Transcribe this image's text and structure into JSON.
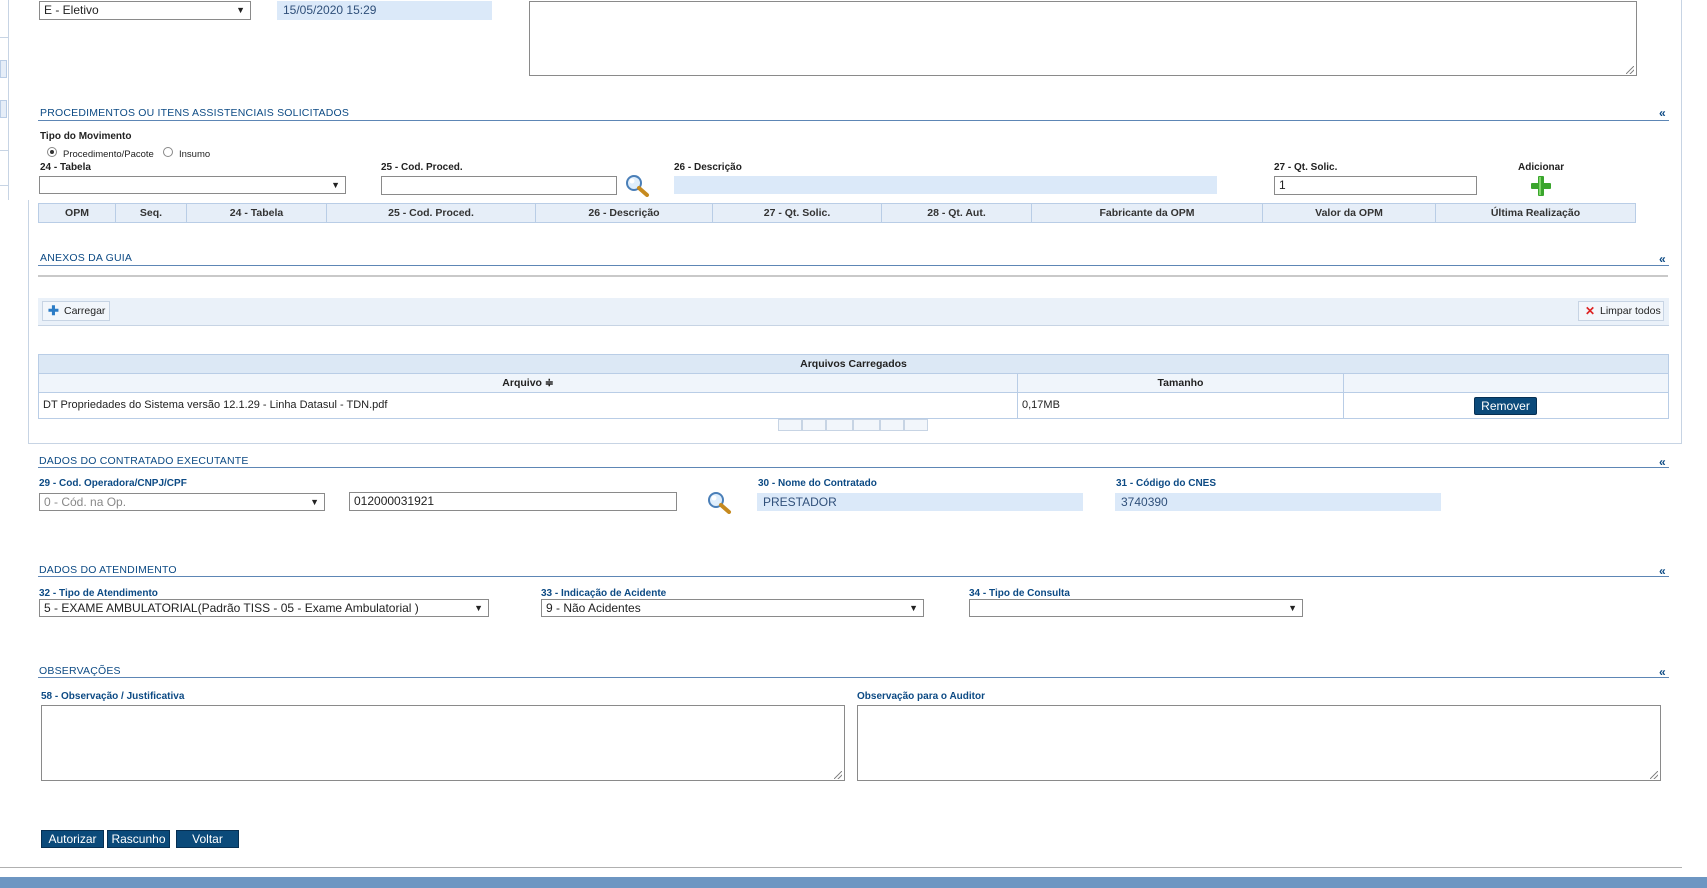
{
  "top": {
    "carater_select": "E - Eletivo",
    "date_value": "15/05/2020 15:29"
  },
  "procedimentos": {
    "title": "PROCEDIMENTOS OU ITENS ASSISTENCIAIS SOLICITADOS",
    "collapse": "«",
    "tipo_movimento_label": "Tipo do Movimento",
    "radio_procedimento": "Procedimento/Pacote",
    "radio_insumo": "Insumo",
    "tabela_label": "24 - Tabela",
    "tabela_value": "",
    "cod_proced_label": "25 - Cod. Proced.",
    "cod_proced_value": "",
    "descricao_label": "26 - Descrição",
    "descricao_value": "",
    "qt_solic_label": "27 - Qt. Solic.",
    "qt_solic_value": "1",
    "adicionar_label": "Adicionar",
    "columns": [
      "OPM",
      "Seq.",
      "24 - Tabela",
      "25 - Cod. Proced.",
      "26 - Descrição",
      "27 - Qt. Solic.",
      "28 - Qt. Aut.",
      "Fabricante da OPM",
      "Valor da OPM",
      "Última Realização"
    ]
  },
  "anexos": {
    "title": "ANEXOS DA GUIA",
    "collapse": "«",
    "carregar_label": "Carregar",
    "limpar_label": "Limpar todos",
    "table_title": "Arquivos Carregados",
    "col_arquivo": "Arquivo ≑",
    "col_tamanho": "Tamanho",
    "files": [
      {
        "name": "DT Propriedades do Sistema versão 12.1.29 - Linha Datasul - TDN.pdf",
        "size": "0,17MB",
        "action": "Remover"
      }
    ]
  },
  "contratado": {
    "title": "DADOS DO CONTRATADO EXECUTANTE",
    "collapse": "«",
    "cod_operadora_label": "29 - Cod. Operadora/CNPJ/CPF",
    "cod_operadora_select": "0 - Cód. na Op.",
    "cod_operadora_value": "012000031921",
    "nome_label": "30 - Nome do Contratado",
    "nome_value": "PRESTADOR",
    "cnes_label": "31 - Código do CNES",
    "cnes_value": "3740390"
  },
  "atendimento": {
    "title": "DADOS DO ATENDIMENTO",
    "collapse": "«",
    "tipo_atendimento_label": "32 - Tipo de Atendimento",
    "tipo_atendimento_value": "5 - EXAME AMBULATORIAL(Padrão TISS - 05 - Exame Ambulatorial )",
    "indicacao_label": "33 - Indicação de Acidente",
    "indicacao_value": "9 - Não Acidentes",
    "tipo_consulta_label": "34 - Tipo de Consulta",
    "tipo_consulta_value": ""
  },
  "observacoes": {
    "title": "OBSERVAÇÕES",
    "collapse": "«",
    "obs_label": "58 - Observação / Justificativa",
    "auditor_label": "Observação para o Auditor"
  },
  "actions": {
    "autorizar": "Autorizar",
    "rascunho": "Rascunho",
    "voltar": "Voltar"
  },
  "colors": {
    "accent": "#0c4a84",
    "button": "#0b4a7a",
    "readonly_bg": "#dbe9f9",
    "header_bg": "#e6eef8",
    "footer_bar": "#6d96c2"
  }
}
